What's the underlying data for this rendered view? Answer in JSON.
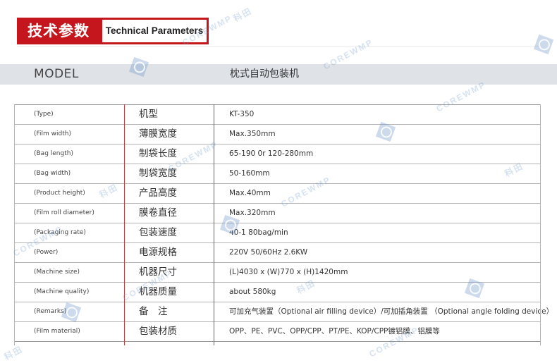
{
  "header": {
    "title_cn": "技术参数",
    "title_en": "Technical Parameters"
  },
  "model": {
    "label": "MODEL",
    "value": "枕式自动包装机"
  },
  "rows": [
    {
      "en": "(Type)",
      "cn": "机型",
      "value": "KT-350"
    },
    {
      "en": "(Film width)",
      "cn": "薄膜宽度",
      "value": "Max.350mm"
    },
    {
      "en": "(Bag length)",
      "cn": "制袋长度",
      "value": "65-190 0r 120-280mm"
    },
    {
      "en": "(Bag width)",
      "cn": "制袋宽度",
      "value": "50-160mm"
    },
    {
      "en": "(Product height)",
      "cn": "产品高度",
      "value": "Max.40mm"
    },
    {
      "en": "(Film roll diameter)",
      "cn": "膜卷直径",
      "value": "Max.320mm"
    },
    {
      "en": "(Packaging rate)",
      "cn": "包装速度",
      "value": "40-1 80bag/min"
    },
    {
      "en": "(Power)",
      "cn": "电源规格",
      "value": "220V 50/60Hz 2.6KW"
    },
    {
      "en": "(Machine size)",
      "cn": "机器尺寸",
      "value": "(L)4030 x (W)770 x (H)1420mm"
    },
    {
      "en": "(Machine quality)",
      "cn": "机器质量",
      "value": "about 580kg"
    },
    {
      "en": "(Remarks)",
      "cn": "备　注",
      "value": "可加充气装置（Optional air filling device）/可加插角装置 （Optional angle folding device）"
    },
    {
      "en": "(Film material)",
      "cn": "包装材质",
      "value": "OPP、PE、PVC、OPP/CPP、PT/PE、KOP/CPP镀铝膜、铝膜等"
    }
  ],
  "watermark": {
    "text": "COREWMP",
    "text_cn": "科田"
  },
  "colors": {
    "brand_red": "#c4161c",
    "band_gray": "#dfe3e8",
    "divider_red": "#c93a3a"
  }
}
